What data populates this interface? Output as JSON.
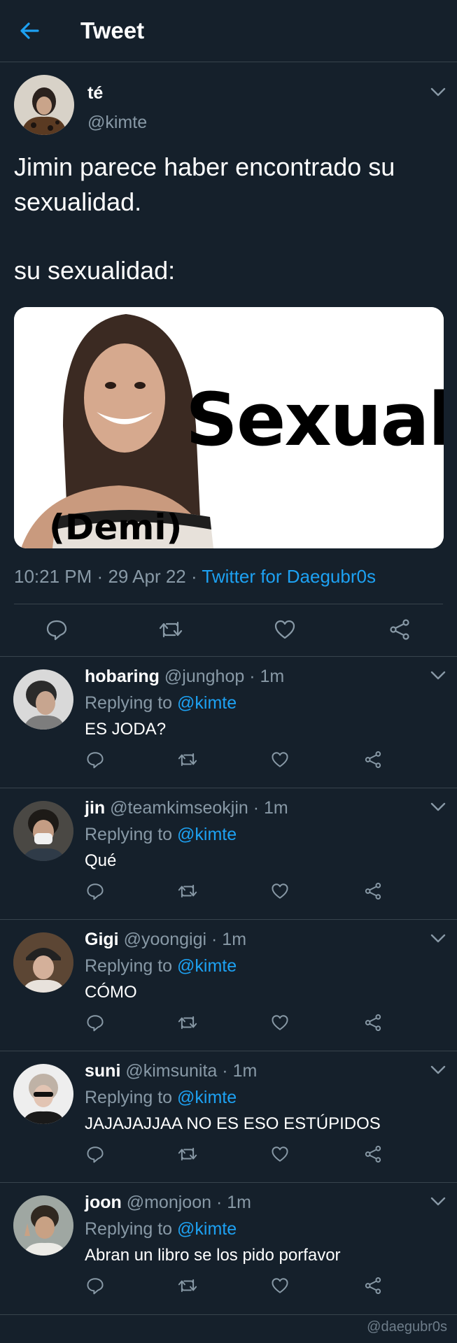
{
  "header": {
    "back_icon": "arrow-left-icon",
    "title": "Tweet"
  },
  "colors": {
    "background": "#15202b",
    "accent": "#1da1f2",
    "secondary_text": "#8899a6",
    "divider": "#38444d"
  },
  "tweet": {
    "display_name": "té",
    "handle": "@kimte",
    "text_line_1": "Jimin parece haber encontrado su sexualidad.",
    "text_line_2": "su sexualidad:",
    "media": {
      "word": "Sexual",
      "caption": "(Demi)"
    },
    "time": "10:21 PM",
    "date": "29 Apr 22",
    "separator": "·",
    "source": "Twitter for Daegubr0s",
    "actions": [
      "reply-icon",
      "retweet-icon",
      "like-icon",
      "share-icon"
    ]
  },
  "replies": [
    {
      "name": "hobaring",
      "handle": "@junghop",
      "time": "· 1m",
      "replying_label": "Replying to",
      "mention": "@kimte",
      "text": "ES JODA?"
    },
    {
      "name": "jin",
      "handle": "@teamkimseokjin",
      "time": "· 1m",
      "replying_label": "Replying to",
      "mention": "@kimte",
      "text": "Qué"
    },
    {
      "name": "Gigi",
      "handle": "@yoongigi",
      "time": "· 1m",
      "replying_label": "Replying to",
      "mention": "@kimte",
      "text": "CÓMO"
    },
    {
      "name": "suni",
      "handle": "@kimsunita",
      "time": "· 1m",
      "replying_label": "Replying to",
      "mention": "@kimte",
      "text": "JAJAJAJJAA NO ES ESO ESTÚPIDOS"
    },
    {
      "name": "joon",
      "handle": "@monjoon",
      "time": "· 1m",
      "replying_label": "Replying to",
      "mention": "@kimte",
      "text": "Abran un libro se los pido porfavor"
    }
  ],
  "watermark": "@daegubr0s"
}
